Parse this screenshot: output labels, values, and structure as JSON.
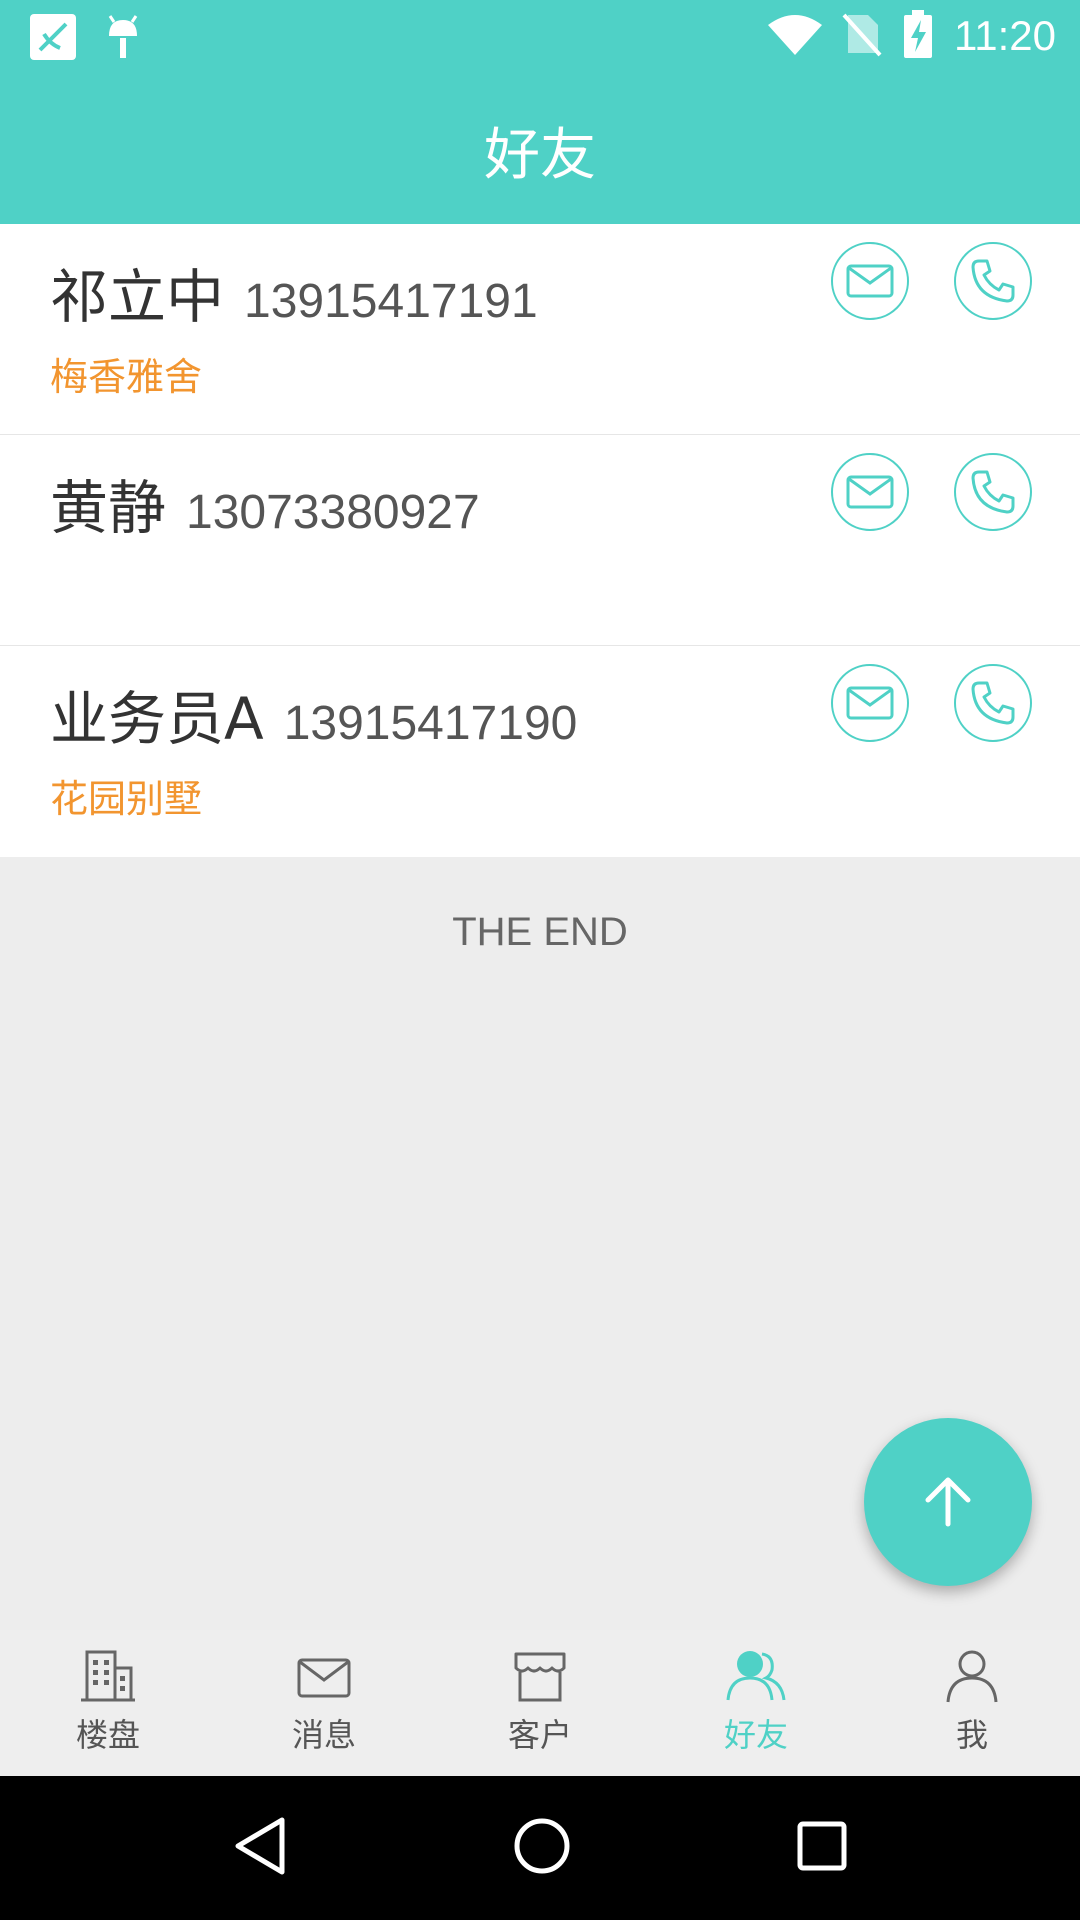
{
  "status_bar": {
    "time": "11:20",
    "left_icons": [
      "app-notification-icon",
      "android-debug-icon"
    ],
    "right_icons": [
      "wifi-icon",
      "no-sim-icon",
      "battery-charging-icon"
    ]
  },
  "header": {
    "title": "好友"
  },
  "friends": [
    {
      "name": "祁立中",
      "phone": "13915417191",
      "company": "梅香雅舍"
    },
    {
      "name": "黄静",
      "phone": "13073380927",
      "company": ""
    },
    {
      "name": "业务员A",
      "phone": "13915417190",
      "company": "花园别墅"
    }
  ],
  "list_footer": "THE END",
  "tabs": [
    {
      "label": "楼盘",
      "icon": "building-icon",
      "active": false
    },
    {
      "label": "消息",
      "icon": "message-icon",
      "active": false
    },
    {
      "label": "客户",
      "icon": "store-icon",
      "active": false
    },
    {
      "label": "好友",
      "icon": "friends-icon",
      "active": true
    },
    {
      "label": "我",
      "icon": "person-icon",
      "active": false
    }
  ],
  "colors": {
    "accent": "#4fd1c6",
    "company": "#f2952f",
    "text": "#333333"
  }
}
